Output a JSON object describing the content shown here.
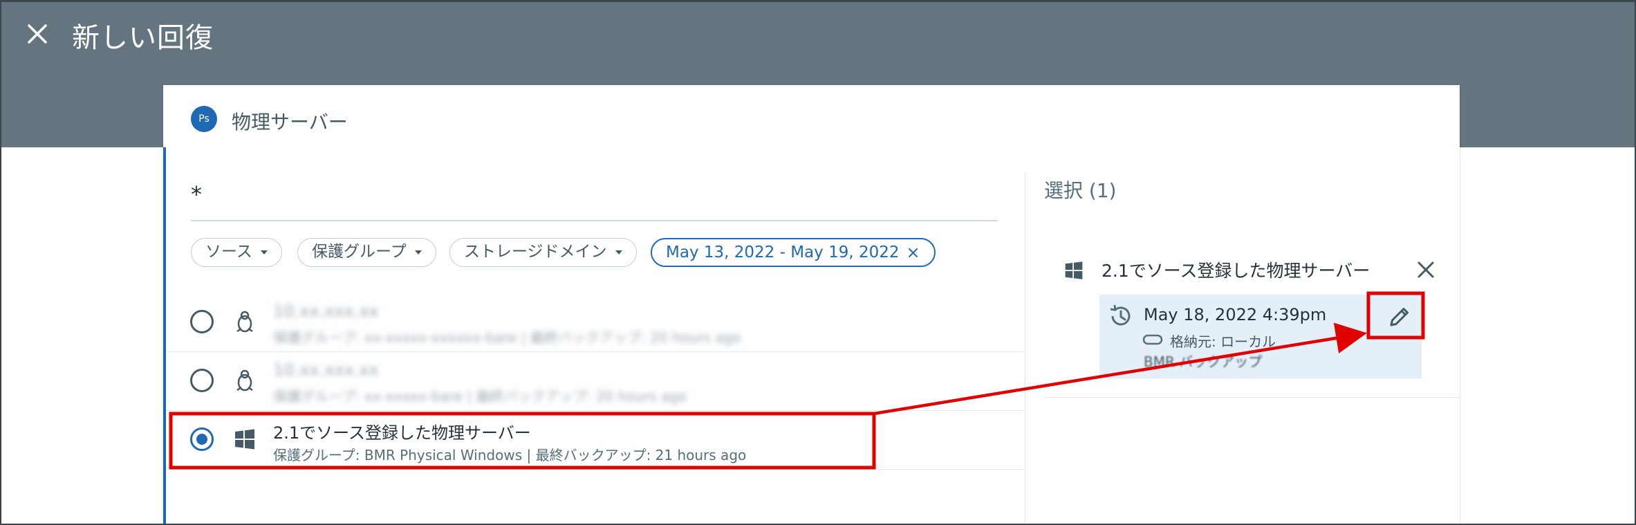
{
  "header": {
    "title": "新しい回復",
    "close_icon": "close-icon"
  },
  "card": {
    "badge": "Ps",
    "title": "物理サーバー"
  },
  "search": {
    "value": "*"
  },
  "filters": [
    {
      "label": "ソース",
      "icon": "caret-down-icon"
    },
    {
      "label": "保護グループ",
      "icon": "caret-down-icon"
    },
    {
      "label": "ストレージドメイン",
      "icon": "caret-down-icon"
    },
    {
      "label": "May 13, 2022 - May 19, 2022",
      "icon": "close-icon",
      "active": true
    }
  ],
  "rows": [
    {
      "icon": "linux-icon",
      "name": "10.xx.xxx.xx",
      "meta": "保護グループ: xx-xxxxx-xxxxxx-bare  |  最終バックアップ: 20 hours ago",
      "selected": false,
      "obscured": true
    },
    {
      "icon": "linux-icon",
      "name": "10.xx.xxx.xx",
      "meta": "保護グループ: xx-xxxxx-bare  |  最終バックアップ: 20 hours ago",
      "selected": false,
      "obscured": true
    },
    {
      "icon": "windows-icon",
      "name": "2.1でソース登録した物理サーバー",
      "meta": "保護グループ:  BMR Physical Windows   |   最終バックアップ: 21 hours ago",
      "selected": true,
      "obscured": false
    }
  ],
  "selection": {
    "title": "選択 (1)",
    "item_name": "2.1でソース登録した物理サーバー",
    "recovery_point": "May 18, 2022 4:39pm",
    "storage": "格納元: ローカル",
    "type": "BMR バックアップ"
  },
  "annotations": {
    "highlight_color": "#e00000"
  },
  "colors": {
    "header_bg": "#647580",
    "accent": "#1f68b3",
    "selection_bg": "#e4eff8"
  }
}
